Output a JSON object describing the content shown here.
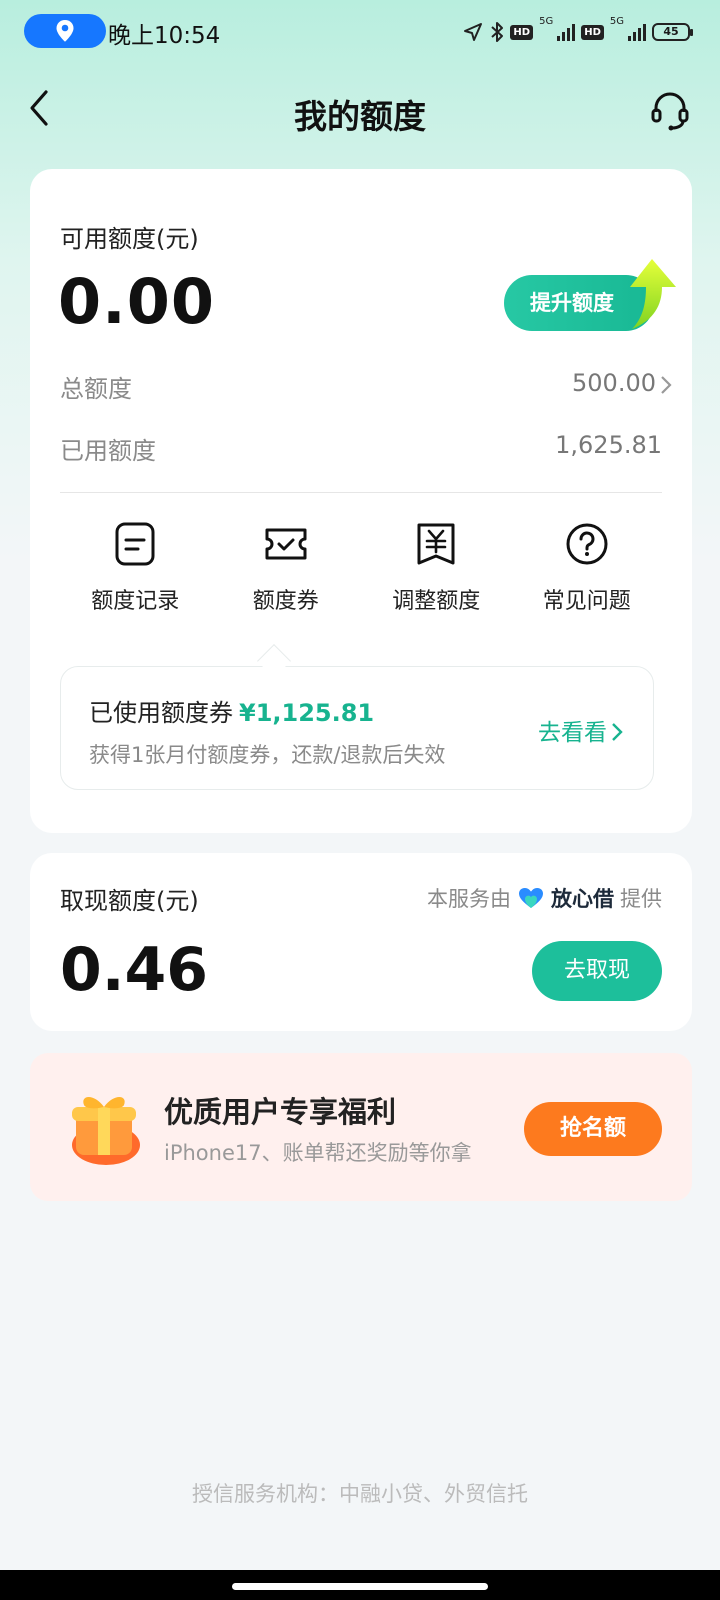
{
  "status_bar": {
    "time": "晚上10:54",
    "battery": "45",
    "hd_label": "HD",
    "network_label": "5G"
  },
  "nav": {
    "title": "我的额度"
  },
  "credit": {
    "available_label": "可用额度(元)",
    "available_value": "0.00",
    "raise_button": "提升额度",
    "total_label": "总额度",
    "total_value": "500.00",
    "used_label": "已用额度",
    "used_value": "1,625.81"
  },
  "tools": [
    {
      "label": "额度记录",
      "icon": "record-icon"
    },
    {
      "label": "额度券",
      "icon": "coupon-ticket-icon"
    },
    {
      "label": "调整额度",
      "icon": "yuan-document-icon"
    },
    {
      "label": "常见问题",
      "icon": "question-icon"
    }
  ],
  "coupon": {
    "title": "已使用额度券",
    "amount": "¥1,125.81",
    "subtitle": "获得1张月付额度券，还款/退款后失效",
    "link": "去看看"
  },
  "cash": {
    "label": "取现额度(元)",
    "provider_prefix": "本服务由",
    "provider_brand": "放心借",
    "provider_suffix": "提供",
    "value": "0.46",
    "button": "去取现"
  },
  "promo": {
    "title": "优质用户专享福利",
    "subtitle": "iPhone17、账单帮还奖励等你拿",
    "button": "抢名额"
  },
  "footer": {
    "text": "授信服务机构：中融小贷、外贸信托"
  },
  "colors": {
    "accent": "#1dbf9b",
    "orange": "#fd7a1e",
    "location_pill": "#1677ff"
  }
}
